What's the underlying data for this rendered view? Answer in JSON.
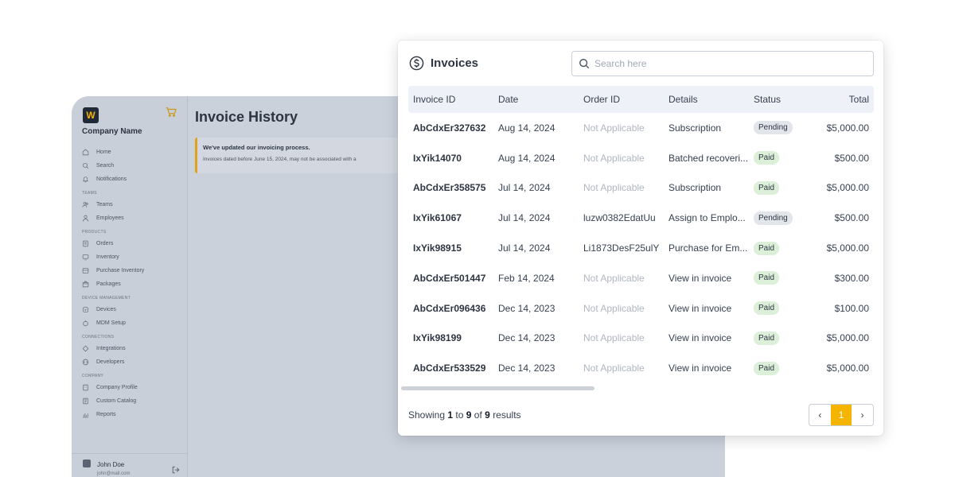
{
  "sidebar": {
    "logo_letter": "W",
    "company_name": "Company Name",
    "groups": [
      {
        "label": "",
        "items": [
          {
            "label": "Home",
            "icon": "home-icon"
          },
          {
            "label": "Search",
            "icon": "search-icon"
          },
          {
            "label": "Notifications",
            "icon": "bell-icon"
          }
        ]
      },
      {
        "label": "TEAMS",
        "items": [
          {
            "label": "Teams",
            "icon": "users-icon"
          },
          {
            "label": "Employees",
            "icon": "user-icon"
          }
        ]
      },
      {
        "label": "PRODUCTS",
        "items": [
          {
            "label": "Orders",
            "icon": "clipboard-icon"
          },
          {
            "label": "Inventory",
            "icon": "monitor-icon"
          },
          {
            "label": "Purchase Inventory",
            "icon": "cart-icon"
          },
          {
            "label": "Packages",
            "icon": "box-icon"
          }
        ]
      },
      {
        "label": "DEVICE MANAGEMENT",
        "items": [
          {
            "label": "Devices",
            "icon": "device-icon"
          },
          {
            "label": "MDM Setup",
            "icon": "settings-icon"
          }
        ]
      },
      {
        "label": "CONNECTIONS",
        "items": [
          {
            "label": "Integrations",
            "icon": "plug-icon"
          },
          {
            "label": "Developers",
            "icon": "code-icon"
          }
        ]
      },
      {
        "label": "COMPANY",
        "items": [
          {
            "label": "Company Profile",
            "icon": "building-icon"
          },
          {
            "label": "Custom Catalog",
            "icon": "catalog-icon"
          },
          {
            "label": "Reports",
            "icon": "chart-icon"
          }
        ]
      }
    ],
    "user": {
      "name": "John Doe",
      "email": "john@mail.com"
    }
  },
  "main": {
    "title": "Invoice History",
    "notice": {
      "title": "We've updated our invoicing process.",
      "text": "Invoices dated before June 15, 2024, may not be associated with a"
    }
  },
  "modal": {
    "title": "Invoices",
    "search_placeholder": "Search here",
    "columns": [
      "Invoice ID",
      "Date",
      "Order ID",
      "Details",
      "Status",
      "Total"
    ],
    "rows": [
      {
        "id": "AbCdxEr327632",
        "date": "Aug 14, 2024",
        "order": "Not Applicable",
        "details": "Subscription",
        "status": "Pending",
        "total": "$5,000.00"
      },
      {
        "id": "IxYik14070",
        "date": "Aug 14, 2024",
        "order": "Not Applicable",
        "details": "Batched recoveri...",
        "status": "Paid",
        "total": "$500.00"
      },
      {
        "id": "AbCdxEr358575",
        "date": "Jul 14, 2024",
        "order": "Not Applicable",
        "details": "Subscription",
        "status": "Paid",
        "total": "$5,000.00"
      },
      {
        "id": "IxYik61067",
        "date": "Jul 14, 2024",
        "order": "luzw0382EdatUu",
        "details": "Assign to Emplo...",
        "status": "Pending",
        "total": "$500.00"
      },
      {
        "id": "IxYik98915",
        "date": "Jul 14, 2024",
        "order": "Li1873DesF25ulY",
        "details": "Purchase for Em...",
        "status": "Paid",
        "total": "$5,000.00"
      },
      {
        "id": "AbCdxEr501447",
        "date": "Feb 14, 2024",
        "order": "Not Applicable",
        "details": "View in invoice",
        "status": "Paid",
        "total": "$300.00"
      },
      {
        "id": "AbCdxEr096436",
        "date": "Dec 14, 2023",
        "order": "Not Applicable",
        "details": "View in invoice",
        "status": "Paid",
        "total": "$100.00"
      },
      {
        "id": "IxYik98199",
        "date": "Dec 14, 2023",
        "order": "Not Applicable",
        "details": "View in invoice",
        "status": "Paid",
        "total": "$5,000.00"
      },
      {
        "id": "AbCdxEr533529",
        "date": "Dec 14, 2023",
        "order": "Not Applicable",
        "details": "View in invoice",
        "status": "Paid",
        "total": "$5,000.00"
      }
    ],
    "footer": {
      "showing": "Showing",
      "from": "1",
      "to_word": "to",
      "to": "9",
      "of_word": "of",
      "total": "9",
      "results_word": "results"
    },
    "pagination": {
      "prev": "‹",
      "current": "1",
      "next": "›"
    }
  },
  "colors": {
    "accent": "#f5b400",
    "paid_badge": "#dcefd9",
    "pending_badge": "#e2e5ea"
  }
}
